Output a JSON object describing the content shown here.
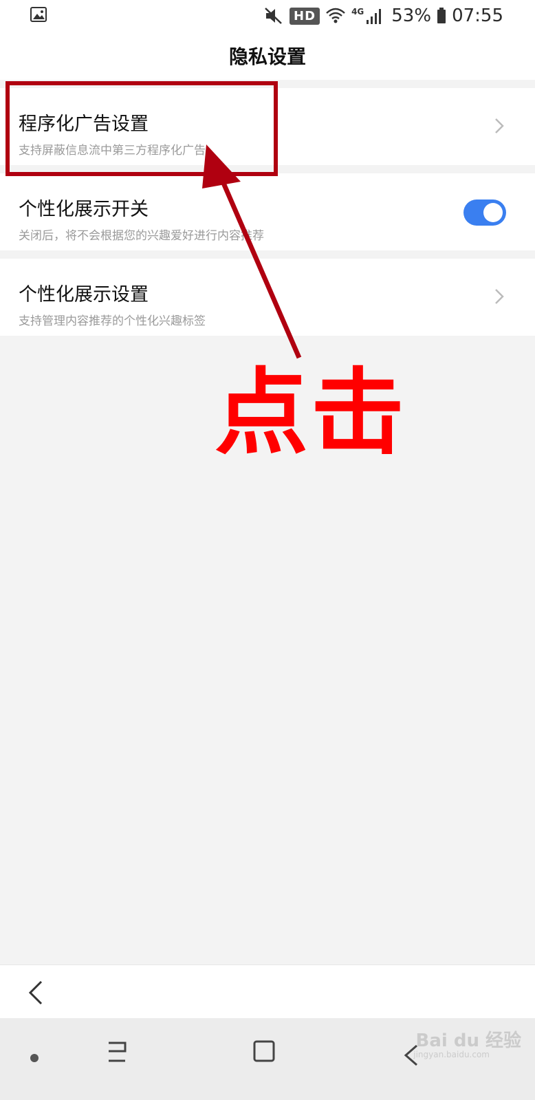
{
  "status_bar": {
    "hd_label": "HD",
    "network_label": "4G",
    "battery_percent": "53%",
    "time": "07:55",
    "icons": [
      "gallery-icon",
      "mute-icon",
      "wifi-icon",
      "signal-icon",
      "battery-icon"
    ]
  },
  "header": {
    "title": "隐私设置"
  },
  "settings": {
    "items": [
      {
        "title": "程序化广告设置",
        "subtitle": "支持屏蔽信息流中第三方程序化广告",
        "control": "chevron"
      },
      {
        "title": "个性化展示开关",
        "subtitle": "关闭后，将不会根据您的兴趣爱好进行内容推荐",
        "control": "toggle",
        "toggle_on": true
      },
      {
        "title": "个性化展示设置",
        "subtitle": "支持管理内容推荐的个性化兴趣标签",
        "control": "chevron"
      }
    ]
  },
  "annotation": {
    "text": "点击",
    "color": "#ff0000",
    "box_color": "#b00010"
  },
  "watermark": {
    "brand": "Bai du 经验",
    "url": "jingyan.baidu.com"
  },
  "colors": {
    "toggle_on": "#3a7ff0",
    "background": "#f3f3f3"
  }
}
